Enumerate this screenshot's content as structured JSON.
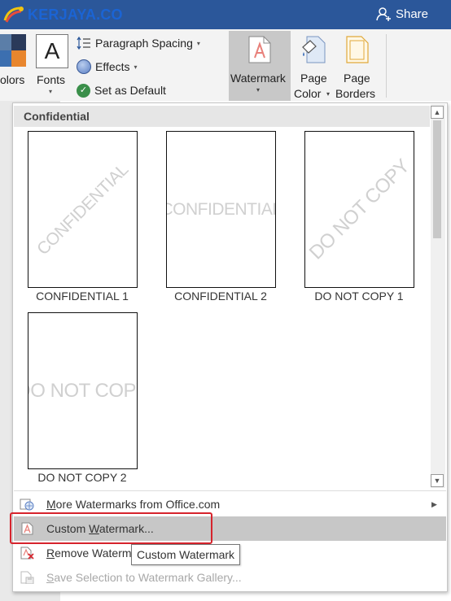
{
  "titlebar": {
    "logo_text": "KERJAYA.CO",
    "share_label": "Share"
  },
  "ribbon": {
    "colors_label": "olors",
    "fonts_letter": "A",
    "fonts_label": "Fonts",
    "paragraph_spacing": "Paragraph Spacing",
    "effects": "Effects",
    "set_as_default": "Set as Default",
    "watermark_label": "Watermark",
    "page_color_line1": "Page",
    "page_color_line2": "Color",
    "page_borders_line1": "Page",
    "page_borders_line2": "Borders"
  },
  "gallery": {
    "header": "Confidential",
    "items": [
      {
        "label": "CONFIDENTIAL 1",
        "watermark": "CONFIDENTIAL"
      },
      {
        "label": "CONFIDENTIAL 2",
        "watermark": "CONFIDENTIAL"
      },
      {
        "label": "DO NOT COPY 1",
        "watermark": "DO NOT COPY"
      },
      {
        "label": "DO NOT COPY 2",
        "watermark": "DO NOT COPY"
      }
    ]
  },
  "menu": {
    "more_watermarks": "More Watermarks from Office.com",
    "custom_watermark": "Custom Watermark...",
    "remove_watermark": "Remove Waterm",
    "save_selection": "Save Selection to Watermark Gallery..."
  },
  "tooltip": "Custom Watermark",
  "colors": {
    "titlebar": "#2b579a",
    "highlight": "#d6232c",
    "watermark_icon": "#e8807a"
  }
}
